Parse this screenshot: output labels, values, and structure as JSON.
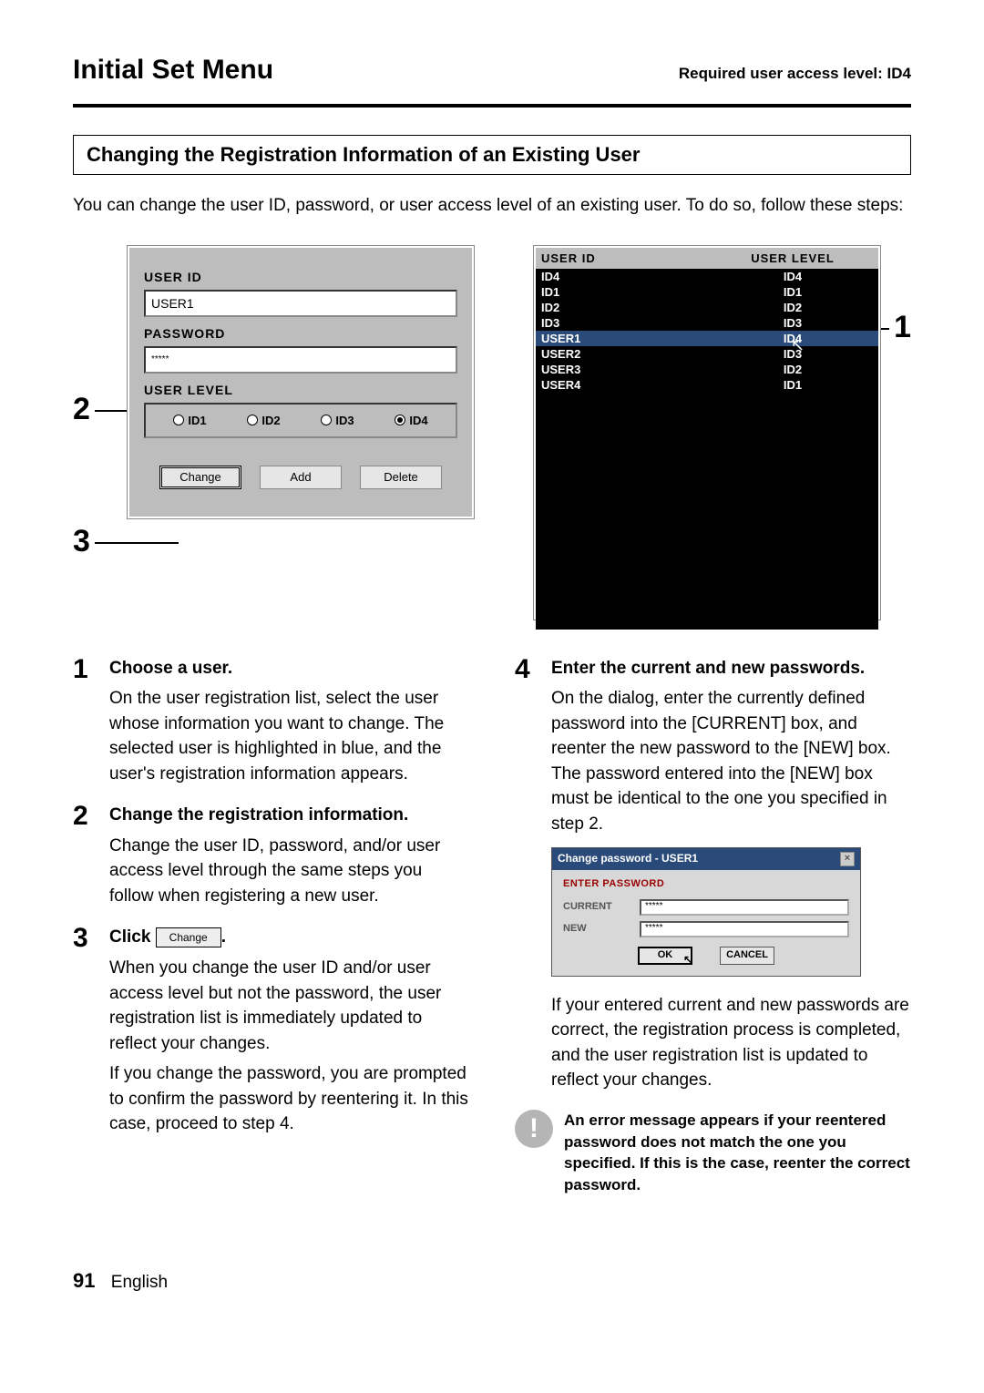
{
  "header": {
    "title": "Initial Set Menu",
    "access": "Required user access level: ID4"
  },
  "section_heading": "Changing the Registration Information of an Existing User",
  "intro": "You can change the user ID, password, or user access level of an existing user. To do so, follow these steps:",
  "form": {
    "user_id_label": "USER ID",
    "user_id_value": "USER1",
    "password_label": "PASSWORD",
    "password_value": "*****",
    "user_level_label": "USER LEVEL",
    "levels": {
      "id1": "ID1",
      "id2": "ID2",
      "id3": "ID3",
      "id4": "ID4"
    },
    "buttons": {
      "change": "Change",
      "add": "Add",
      "delete": "Delete"
    }
  },
  "list": {
    "col1": "USER ID",
    "col2": "USER LEVEL",
    "rows": [
      {
        "id": "ID4",
        "lvl": "ID4",
        "sel": false
      },
      {
        "id": "ID1",
        "lvl": "ID1",
        "sel": false
      },
      {
        "id": "ID2",
        "lvl": "ID2",
        "sel": false
      },
      {
        "id": "ID3",
        "lvl": "ID3",
        "sel": false
      },
      {
        "id": "USER1",
        "lvl": "ID4",
        "sel": true
      },
      {
        "id": "USER2",
        "lvl": "ID3",
        "sel": false
      },
      {
        "id": "USER3",
        "lvl": "ID2",
        "sel": false
      },
      {
        "id": "USER4",
        "lvl": "ID1",
        "sel": false
      }
    ]
  },
  "callouts": {
    "one": "1",
    "two": "2",
    "three": "3"
  },
  "steps": {
    "s1": {
      "num": "1",
      "title": "Choose a user.",
      "body": "On the user registration list, select the user whose information you want to change. The selected user is highlighted in blue, and the user's registration information appears."
    },
    "s2": {
      "num": "2",
      "title": "Change the registration information.",
      "body": "Change the user ID, password, and/or user access level through the same steps you follow when registering a new user."
    },
    "s3": {
      "num": "3",
      "title_prefix": "Click",
      "btn": "Change",
      "title_suffix": ".",
      "body1": "When you change the user ID and/or user access level but not the password, the user registration list is immediately updated to reflect your changes.",
      "body2": "If you change the password, you are prompted to confirm the password by reentering it. In this case, proceed to step 4."
    },
    "s4": {
      "num": "4",
      "title": "Enter the current and new passwords.",
      "body": "On the dialog, enter the currently defined password into the [CURRENT] box, and reenter the new password to the [NEW] box. The password entered into the [NEW] box must be identical to the one you specified in step 2.",
      "body_after": "If your entered current and new passwords are correct, the registration process is completed, and the user registration list is updated to reflect your changes."
    }
  },
  "dialog": {
    "title": "Change password - USER1",
    "sub": "ENTER PASSWORD",
    "current_label": "CURRENT",
    "current_value": "*****",
    "new_label": "NEW",
    "new_value": "*****",
    "ok": "OK",
    "cancel": "CANCEL"
  },
  "note": {
    "icon": "!",
    "text": "An error message appears if your reentered password does not match the one you specified. If this is the case, reenter the correct password."
  },
  "footer": {
    "page": "91",
    "lang": "English"
  }
}
